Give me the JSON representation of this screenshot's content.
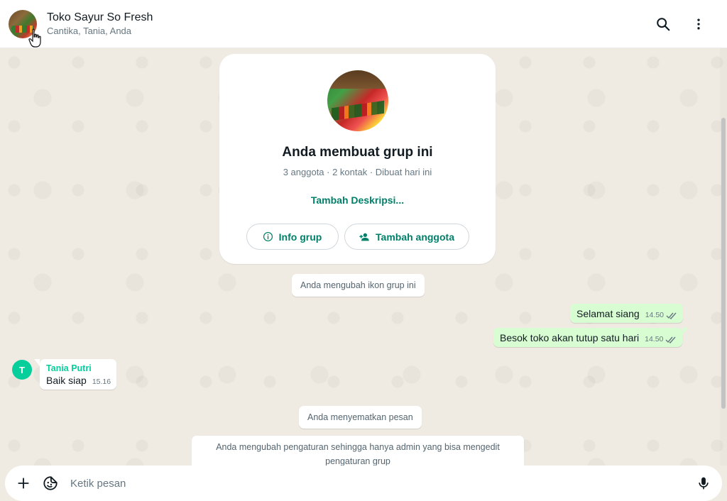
{
  "header": {
    "group_name": "Toko Sayur So Fresh",
    "members": "Cantika, Tania, Anda"
  },
  "info_card": {
    "title": "Anda membuat grup ini",
    "subtitle": "3 anggota · 2 kontak · Dibuat hari ini",
    "add_description": "Tambah Deskripsi...",
    "info_button": "Info grup",
    "add_member_button": "Tambah anggota"
  },
  "messages": {
    "system_icon_change": "Anda mengubah ikon grup ini",
    "out_1": {
      "text": "Selamat siang",
      "time": "14.50"
    },
    "out_2": {
      "text": "Besok toko akan tutup satu hari",
      "time": "14.50"
    },
    "in_1": {
      "sender": "Tania Putri",
      "sender_initial": "T",
      "text": "Baik siap",
      "time": "15.16"
    },
    "system_pin": "Anda menyematkan pesan",
    "system_settings": "Anda mengubah pengaturan sehingga hanya admin yang bisa mengedit pengaturan grup"
  },
  "composer": {
    "placeholder": "Ketik pesan"
  },
  "colors": {
    "accent": "#008069",
    "outgoing_bubble": "#d9fdd3",
    "chat_background": "#efeae2",
    "sender_name": "#06cf9c"
  }
}
